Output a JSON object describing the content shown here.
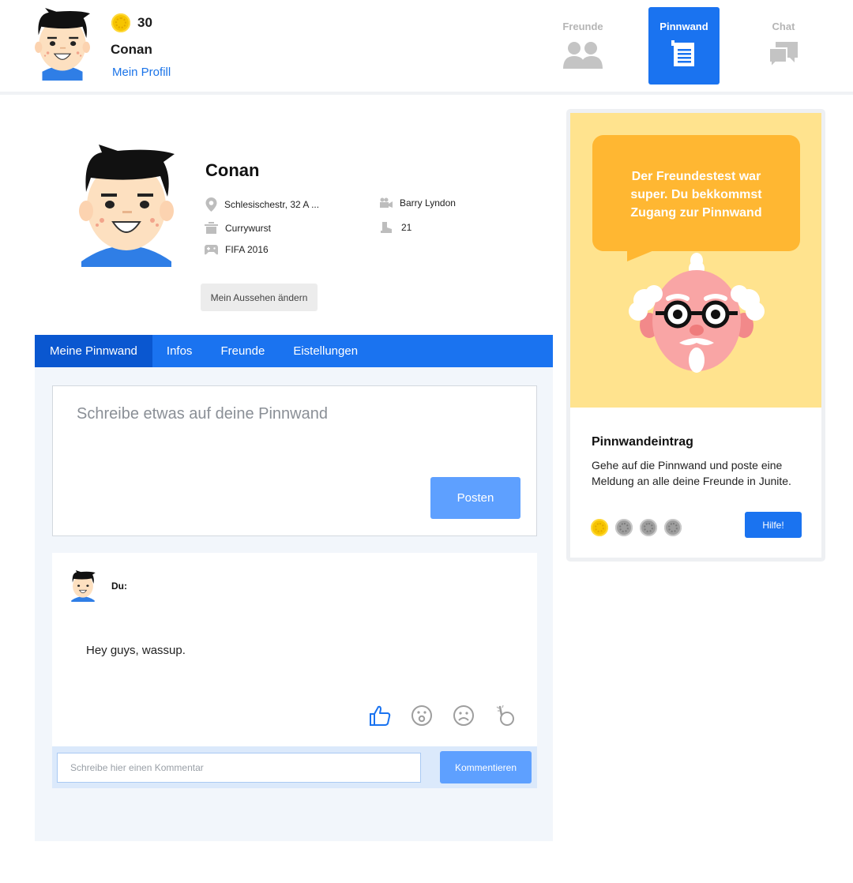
{
  "header": {
    "coins": "30",
    "user_name": "Conan",
    "profile_link": "Mein Profill",
    "nav": [
      {
        "label": "Freunde",
        "icon": "friends-icon"
      },
      {
        "label": "Pinnwand",
        "icon": "wall-icon",
        "active": true
      },
      {
        "label": "Chat",
        "icon": "chat-icon"
      }
    ]
  },
  "profile": {
    "name": "Conan",
    "address": "Schlesischestr, 32 A ...",
    "movie": "Barry Lyndon",
    "food": "Currywurst",
    "age": "21",
    "game": "FIFA 2016",
    "change_look_label": "Mein Aussehen ändern"
  },
  "tabs": [
    "Meine Pinnwand",
    "Infos",
    "Freunde",
    "Eistellungen"
  ],
  "compose": {
    "placeholder": "Schreibe etwas auf deine Pinnwand",
    "post_label": "Posten"
  },
  "post": {
    "author": "Du:",
    "text": "Hey guys, wassup.",
    "reactions": [
      "thumbs-up-icon",
      "surprised-icon",
      "sad-icon",
      "poke-icon"
    ]
  },
  "comment": {
    "placeholder": "Schreibe hier einen Kommentar",
    "button_label": "Kommentieren"
  },
  "side_card": {
    "bubble_text_line1": "Der Freundestest war",
    "bubble_text_line2": "super. Du bekkommst",
    "bubble_text_line3": "Zugang zur Pinnwand",
    "title": "Pinnwandeintrag",
    "description": "Gehe auf die Pinnwand und poste eine Meldung an alle deine Freunde in Junite.",
    "progress_completed": 1,
    "progress_total": 4,
    "help_label": "Hilfe!"
  },
  "colors": {
    "primary": "#1a73f0",
    "primary_dark": "#0a57d0",
    "button_light": "#5ea0ff",
    "coin": "#f6c400",
    "bubble": "#ffb732",
    "illustration_bg": "#ffe38e"
  }
}
